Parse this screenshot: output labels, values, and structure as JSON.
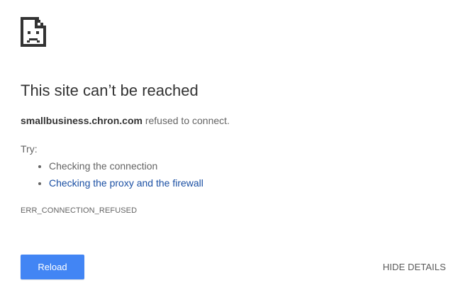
{
  "icon": "sad-page-icon",
  "title": "This site can’t be reached",
  "summary": {
    "host": "smallbusiness.chron.com",
    "message": " refused to connect."
  },
  "try_label": "Try:",
  "suggestions": [
    {
      "text": "Checking the connection",
      "link": false
    },
    {
      "text": "Checking the proxy and the firewall",
      "link": true
    }
  ],
  "error_code": "ERR_CONNECTION_REFUSED",
  "buttons": {
    "reload_label": "Reload",
    "details_label": "HIDE DETAILS"
  },
  "colors": {
    "accent": "#4285f4",
    "link": "#1a4fa3",
    "text": "#646464",
    "heading": "#333333"
  }
}
